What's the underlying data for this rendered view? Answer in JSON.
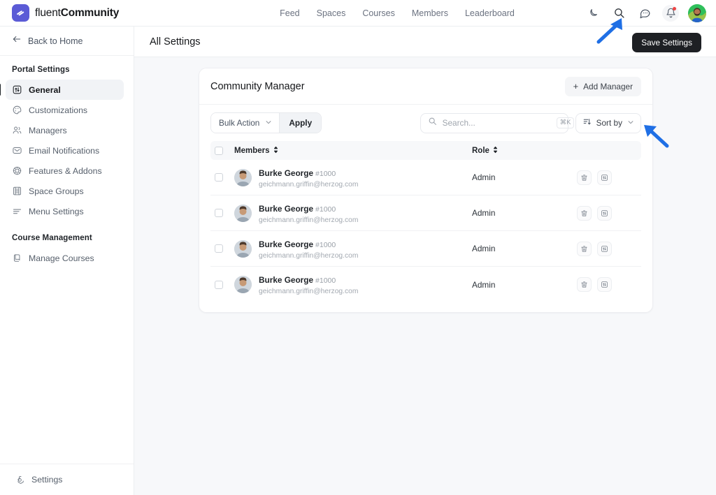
{
  "brand": {
    "light": "fluent",
    "bold": "Community",
    "logo_icon": "fluent-logo-icon",
    "logo_color": "#5b5bd6"
  },
  "topnav": {
    "items": [
      {
        "label": "Feed"
      },
      {
        "label": "Spaces"
      },
      {
        "label": "Courses"
      },
      {
        "label": "Members"
      },
      {
        "label": "Leaderboard"
      }
    ],
    "icons": [
      {
        "name": "dark-mode-moon-icon"
      },
      {
        "name": "search-icon"
      },
      {
        "name": "messages-chat-icon"
      },
      {
        "name": "notifications-bell-icon",
        "badge": true
      }
    ],
    "avatar": {
      "name": "user-avatar"
    }
  },
  "sidebar": {
    "back": {
      "label": "Back to Home",
      "icon": "arrow-left-icon"
    },
    "groups": [
      {
        "title": "Portal Settings",
        "items": [
          {
            "label": "General",
            "icon": "sliders-icon",
            "active": true
          },
          {
            "label": "Customizations",
            "icon": "palette-icon",
            "active": false
          },
          {
            "label": "Managers",
            "icon": "users-icon",
            "active": false
          },
          {
            "label": "Email Notifications",
            "icon": "envelope-icon",
            "active": false
          },
          {
            "label": "Features & Addons",
            "icon": "chip-icon",
            "active": false
          },
          {
            "label": "Space Groups",
            "icon": "layout-grid-icon",
            "active": false
          },
          {
            "label": "Menu Settings",
            "icon": "menu-lines-icon",
            "active": false
          }
        ]
      },
      {
        "title": "Course Management",
        "items": [
          {
            "label": "Manage Courses",
            "icon": "book-copy-icon",
            "active": false
          }
        ]
      }
    ],
    "bottom": {
      "label": "Settings",
      "icon": "gear-icon"
    }
  },
  "header": {
    "title": "All Settings",
    "save_label": "Save Settings",
    "save_bg": "#1e2024"
  },
  "card": {
    "title": "Community Manager",
    "add_manager_label": "Add Manager",
    "add_manager_icon": "plus-icon",
    "toolbar": {
      "bulk_action_label": "Bulk Action",
      "bulk_action_icon": "chevron-down-icon",
      "apply_label": "Apply",
      "search_placeholder": "Search...",
      "search_value": "",
      "search_icon": "search-icon",
      "search_shortcut": "⌘K",
      "sort_label": "Sort by",
      "sort_icon": "sort-lines-icon",
      "sort_chevron": "chevron-down-icon"
    },
    "table": {
      "columns": [
        {
          "key": "checkbox",
          "label": "",
          "icon": "checkbox-icon"
        },
        {
          "key": "members",
          "label": "Members",
          "sortable": true,
          "sort_icon": "sort-updown-icon"
        },
        {
          "key": "role",
          "label": "Role",
          "sortable": true,
          "sort_icon": "sort-updown-icon"
        },
        {
          "key": "actions",
          "label": ""
        }
      ],
      "rows": [
        {
          "name": "Burke George",
          "id": "#1000",
          "email": "geichmann.griffin@herzog.com",
          "role": "Admin",
          "avatar": "member-avatar",
          "delete_icon": "trash-icon",
          "settings_icon": "sliders-square-icon"
        },
        {
          "name": "Burke George",
          "id": "#1000",
          "email": "geichmann.griffin@herzog.com",
          "role": "Admin",
          "avatar": "member-avatar",
          "delete_icon": "trash-icon",
          "settings_icon": "sliders-square-icon"
        },
        {
          "name": "Burke George",
          "id": "#1000",
          "email": "geichmann.griffin@herzog.com",
          "role": "Admin",
          "avatar": "member-avatar",
          "delete_icon": "trash-icon",
          "settings_icon": "sliders-square-icon"
        },
        {
          "name": "Burke George",
          "id": "#1000",
          "email": "geichmann.griffin@herzog.com",
          "role": "Admin",
          "avatar": "member-avatar",
          "delete_icon": "trash-icon",
          "settings_icon": "sliders-square-icon"
        }
      ]
    }
  },
  "annotations": {
    "arrow_color": "#1f6fe5",
    "arrows": [
      {
        "name": "pointer-arrow-to-search-icon",
        "target": "search-icon"
      },
      {
        "name": "pointer-arrow-to-sort-by",
        "target": "sort-by-button"
      }
    ]
  }
}
